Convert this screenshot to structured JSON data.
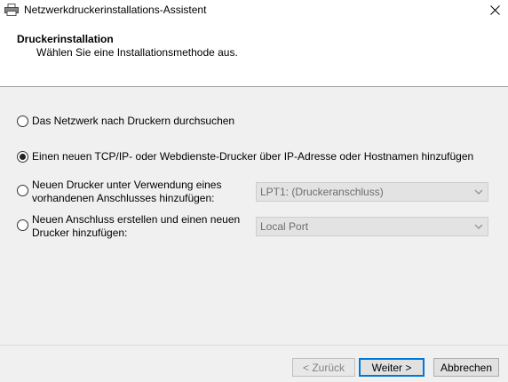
{
  "window": {
    "title": "Netzwerkdruckerinstallations-Assistent",
    "icon": "printer-icon",
    "close_icon": "close-icon"
  },
  "header": {
    "title": "Druckerinstallation",
    "subtitle": "Wählen Sie eine Installationsmethode aus."
  },
  "options": [
    {
      "label": "Das Netzwerk nach Druckern durchsuchen",
      "checked": false
    },
    {
      "label": "Einen neuen TCP/IP- oder Webdienste-Drucker über IP-Adresse oder Hostnamen hinzufügen",
      "checked": true
    },
    {
      "label_line1": "Neuen Drucker unter Verwendung eines",
      "label_line2": "vorhandenen Anschlusses hinzufügen:",
      "checked": false,
      "select_value": "LPT1: (Druckeranschluss)"
    },
    {
      "label_line1": "Neuen Anschluss erstellen und einen neuen",
      "label_line2": "Drucker hinzufügen:",
      "checked": false,
      "select_value": "Local Port"
    }
  ],
  "buttons": {
    "back": "< Zurück",
    "next": "Weiter >",
    "cancel": "Abbrechen"
  }
}
